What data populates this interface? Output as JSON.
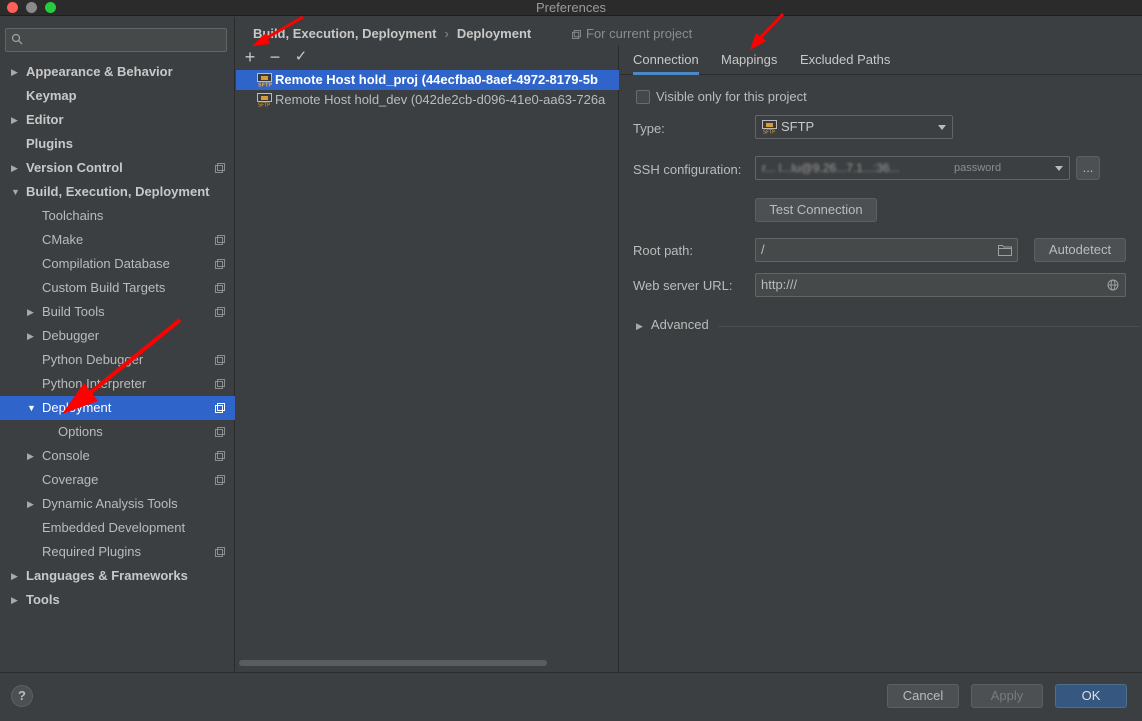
{
  "window": {
    "title": "Preferences"
  },
  "sidebar": {
    "search_placeholder": "",
    "items": [
      {
        "label": "Appearance & Behavior",
        "bold": true
      },
      {
        "label": "Keymap",
        "bold": true
      },
      {
        "label": "Editor",
        "bold": true
      },
      {
        "label": "Plugins",
        "bold": true
      },
      {
        "label": "Version Control",
        "bold": true
      },
      {
        "label": "Build, Execution, Deployment",
        "bold": true
      },
      {
        "label": "Toolchains"
      },
      {
        "label": "CMake"
      },
      {
        "label": "Compilation Database"
      },
      {
        "label": "Custom Build Targets"
      },
      {
        "label": "Build Tools"
      },
      {
        "label": "Debugger"
      },
      {
        "label": "Python Debugger"
      },
      {
        "label": "Python Interpreter"
      },
      {
        "label": "Deployment",
        "selected": true
      },
      {
        "label": "Options"
      },
      {
        "label": "Console"
      },
      {
        "label": "Coverage"
      },
      {
        "label": "Dynamic Analysis Tools"
      },
      {
        "label": "Embedded Development"
      },
      {
        "label": "Required Plugins"
      },
      {
        "label": "Languages & Frameworks",
        "bold": true
      },
      {
        "label": "Tools",
        "bold": true
      }
    ]
  },
  "breadcrumb": {
    "parent": "Build, Execution, Deployment",
    "sep": "›",
    "current": "Deployment"
  },
  "scope_label": "For current project",
  "toolbar": {
    "add": "+",
    "remove": "−",
    "apply": "✓"
  },
  "hosts": [
    {
      "name": "Remote Host hold_proj (44ecfba0-8aef-4972-8179-5b",
      "selected": true,
      "icon": "sftp-icon"
    },
    {
      "name": "Remote Host hold_dev (042de2cb-d096-41e0-aa63-726a",
      "icon": "sftp-icon"
    }
  ],
  "tabs": {
    "connection": "Connection",
    "mappings": "Mappings",
    "excluded": "Excluded Paths"
  },
  "form": {
    "visible_only_label": "Visible only for this project",
    "visible_only_checked": false,
    "type_label": "Type:",
    "type_value": "SFTP",
    "ssh_label": "SSH configuration:",
    "ssh_value": "r... l...lu@9.26...7.1...:36...",
    "ssh_auth": "password",
    "ssh_more": "...",
    "test_connection": "Test Connection",
    "root_path_label": "Root path:",
    "root_path_value": "/",
    "autodetect": "Autodetect",
    "web_url_label": "Web server URL:",
    "web_url_value": "http:///",
    "advanced": "Advanced"
  },
  "footer": {
    "help": "?",
    "cancel": "Cancel",
    "apply": "Apply",
    "ok": "OK"
  },
  "colors": {
    "selection": "#2f65ca",
    "tab_underline": "#4a88c7",
    "annotation_arrow": "#ff0000"
  }
}
